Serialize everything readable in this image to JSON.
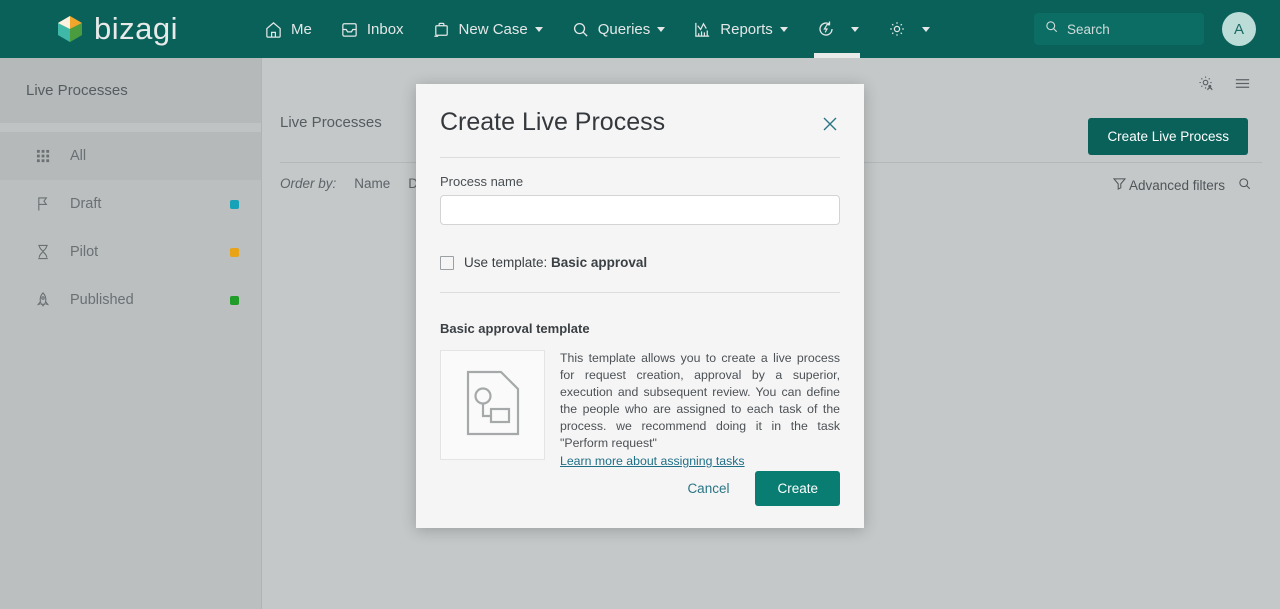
{
  "topnav": {
    "brand": "bizagi",
    "items": [
      {
        "label": "Me",
        "icon": "home-icon",
        "caret": false
      },
      {
        "label": "Inbox",
        "icon": "inbox-icon",
        "caret": false
      },
      {
        "label": "New Case",
        "icon": "briefcase-plus-icon",
        "caret": true
      },
      {
        "label": "Queries",
        "icon": "search-icon",
        "caret": true
      },
      {
        "label": "Reports",
        "icon": "chart-icon",
        "caret": true
      }
    ],
    "refresh_label": "",
    "settings_label": "",
    "search_placeholder": "Search",
    "avatar_initial": "A"
  },
  "sidebar": {
    "title": "Live Processes",
    "items": [
      {
        "label": "All",
        "icon": "grid-icon",
        "dot": "",
        "selected": true
      },
      {
        "label": "Draft",
        "icon": "draft-flag-icon",
        "dot": "#17a2b8",
        "selected": false
      },
      {
        "label": "Pilot",
        "icon": "hourglass-icon",
        "dot": "#e8a317",
        "selected": false
      },
      {
        "label": "Published",
        "icon": "rocket-icon",
        "dot": "#1f9d28",
        "selected": false
      }
    ]
  },
  "content": {
    "heading": "Live Processes",
    "create_button": "Create Live Process",
    "order_by_label": "Order by:",
    "order_options": [
      "Name",
      "Date"
    ],
    "advanced_filters": "Advanced filters"
  },
  "modal": {
    "title": "Create Live Process",
    "close_icon": "close-icon",
    "process_name_label": "Process name",
    "process_name_value": "",
    "process_name_placeholder": "",
    "checkbox_prefix": "Use template: ",
    "checkbox_template_name": "Basic approval",
    "checkbox_checked": false,
    "template_section_title": "Basic approval template",
    "template_thumb_icon": "process-document-icon",
    "template_description": "This template allows you to create a live process for request creation, approval by a superior, execution and subsequent review. You can define the people who are assigned to each task of the process. we recommend doing it in the task \"Perform request\"",
    "template_link": "Learn more about assigning tasks",
    "cancel_button": "Cancel",
    "create_button": "Create"
  },
  "colors": {
    "brand_teal": "#0a6159",
    "button_teal": "#0a7d72",
    "link_blue": "#1f6f87",
    "draft_dot": "#17a2b8",
    "pilot_dot": "#e8a317",
    "published_dot": "#1f9d28",
    "page_gray": "#c4c8c8",
    "sidebar_gray": "#bbbfbf",
    "modal_bg": "#f5f5f5"
  }
}
